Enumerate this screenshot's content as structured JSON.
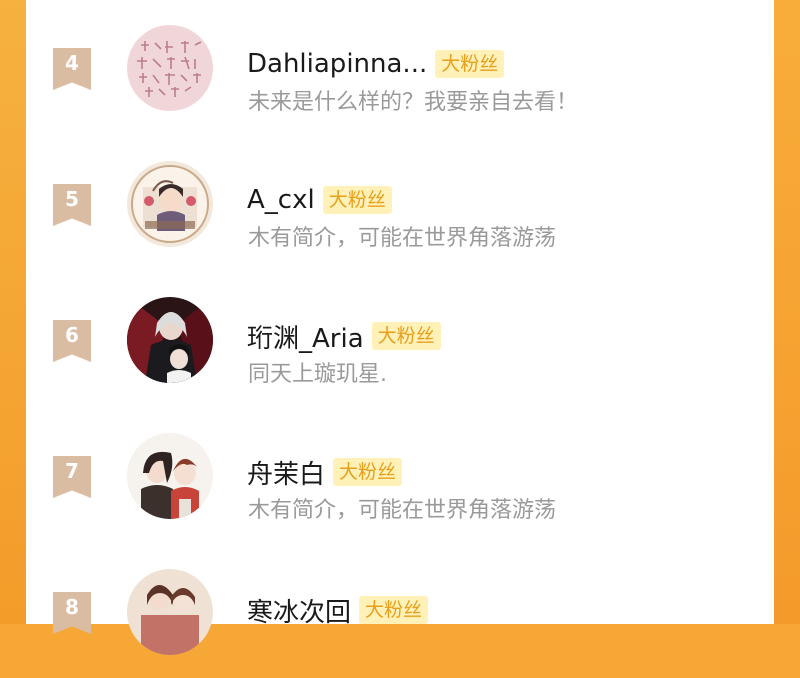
{
  "badge_label": "大粉丝",
  "colors": {
    "frame_orange": "#f7a735",
    "rank_tag": "#d9bca2",
    "badge_bg": "#fff1b8",
    "badge_text": "#e8a01b",
    "bio_text": "#9a9a9a"
  },
  "fans": [
    {
      "rank": "4",
      "name": "Dahliapinna...",
      "bio": "未来是什么样的？我要亲自去看！",
      "badge": "大粉丝",
      "avatar": "calligraphy-avatar"
    },
    {
      "rank": "5",
      "name": "A_cxl",
      "bio": "木有简介，可能在世界角落游荡",
      "badge": "大粉丝",
      "avatar": "anime-character-avatar"
    },
    {
      "rank": "6",
      "name": "珩渊_Aria",
      "bio": "同天上璇玑星.",
      "badge": "大粉丝",
      "avatar": "dark-anime-avatar"
    },
    {
      "rank": "7",
      "name": "舟茉白",
      "bio": "木有简介，可能在世界角落游荡",
      "badge": "大粉丝",
      "avatar": "anime-duo-avatar"
    },
    {
      "rank": "8",
      "name": "寒冰次回",
      "bio": "",
      "badge": "大粉丝",
      "avatar": "anime-couple-avatar"
    }
  ]
}
